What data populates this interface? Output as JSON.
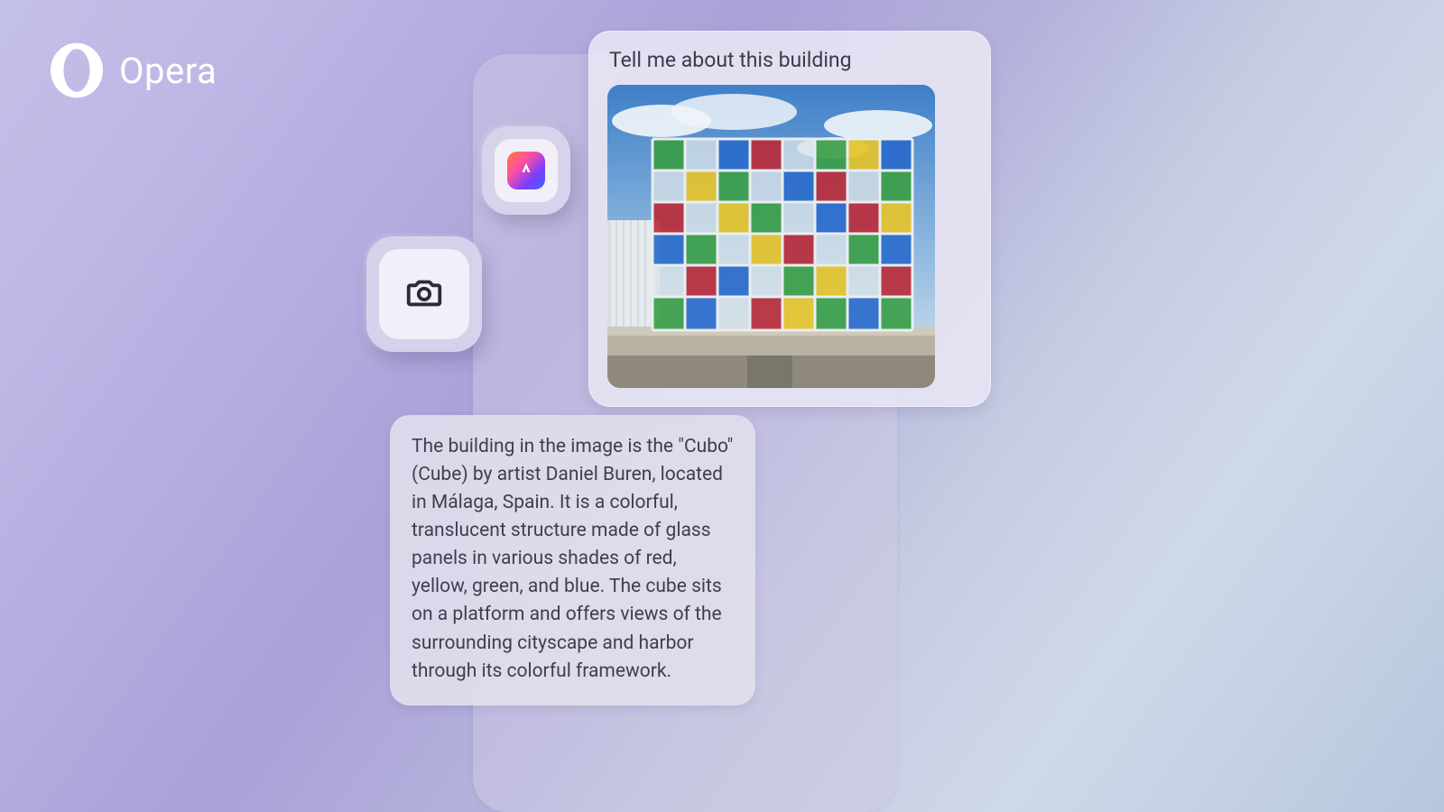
{
  "brand": {
    "name": "Opera"
  },
  "tiles": {
    "ai": {
      "name": "aria-ai-icon"
    },
    "camera": {
      "name": "camera-icon"
    }
  },
  "query": {
    "prompt": "Tell me about this building",
    "image_alt": "Colorful glass cube building against blue sky"
  },
  "response": {
    "text": "The building in the image is the \"Cubo\" (Cube) by artist Daniel Buren, located in Málaga, Spain. It is a colorful, translucent structure made of glass panels in various shades of red, yellow, green, and blue. The cube sits on a platform and offers views of the surrounding cityscape and harbor through its colorful framework."
  }
}
